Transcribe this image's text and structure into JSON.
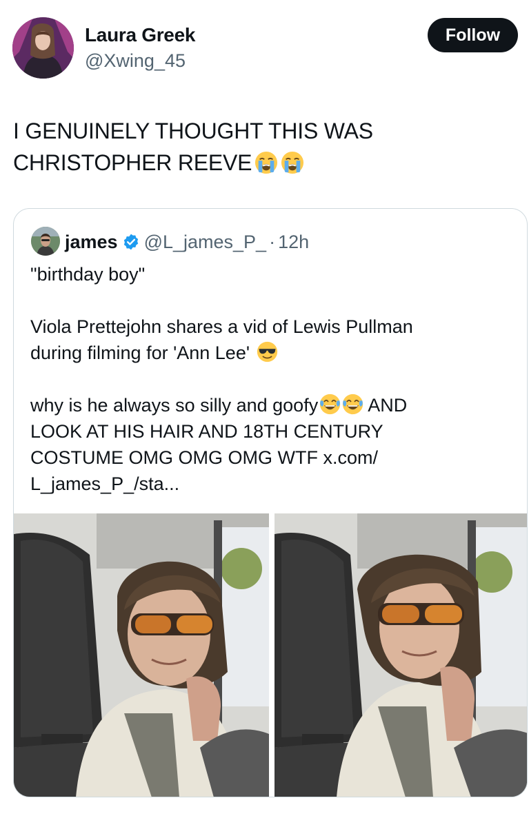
{
  "author": {
    "display_name": "Laura Greek",
    "handle": "@Xwing_45",
    "avatar_icon": "user-avatar"
  },
  "follow_button": {
    "label": "Follow"
  },
  "tweet": {
    "line1": "I GENUINELY THOUGHT THIS WAS",
    "line2": "CHRISTOPHER REEVE",
    "emojis": [
      "loudly-crying-face-icon",
      "loudly-crying-face-icon"
    ]
  },
  "quoted_tweet": {
    "author_name": "james",
    "verified": true,
    "handle": "@L_james_P_",
    "separator": "·",
    "time": "12h",
    "para1": "\"birthday boy\"",
    "para2": "Viola Prettejohn shares a vid of Lewis Pullman\nduring filming for 'Ann Lee'",
    "para3_a": "why is he always so silly and goofy",
    "para3_b": " AND\nLOOK AT HIS HAIR AND 18TH CENTURY\nCOSTUME OMG OMG OMG WTF x.com/\nL_james_P_/sta...",
    "media": [
      "video-frame-1",
      "video-frame-2"
    ]
  },
  "colors": {
    "text_primary": "#0f1419",
    "text_secondary": "#536471",
    "button_bg": "#0f1419",
    "border": "#cfd9de",
    "verified_blue": "#1d9bf0"
  }
}
